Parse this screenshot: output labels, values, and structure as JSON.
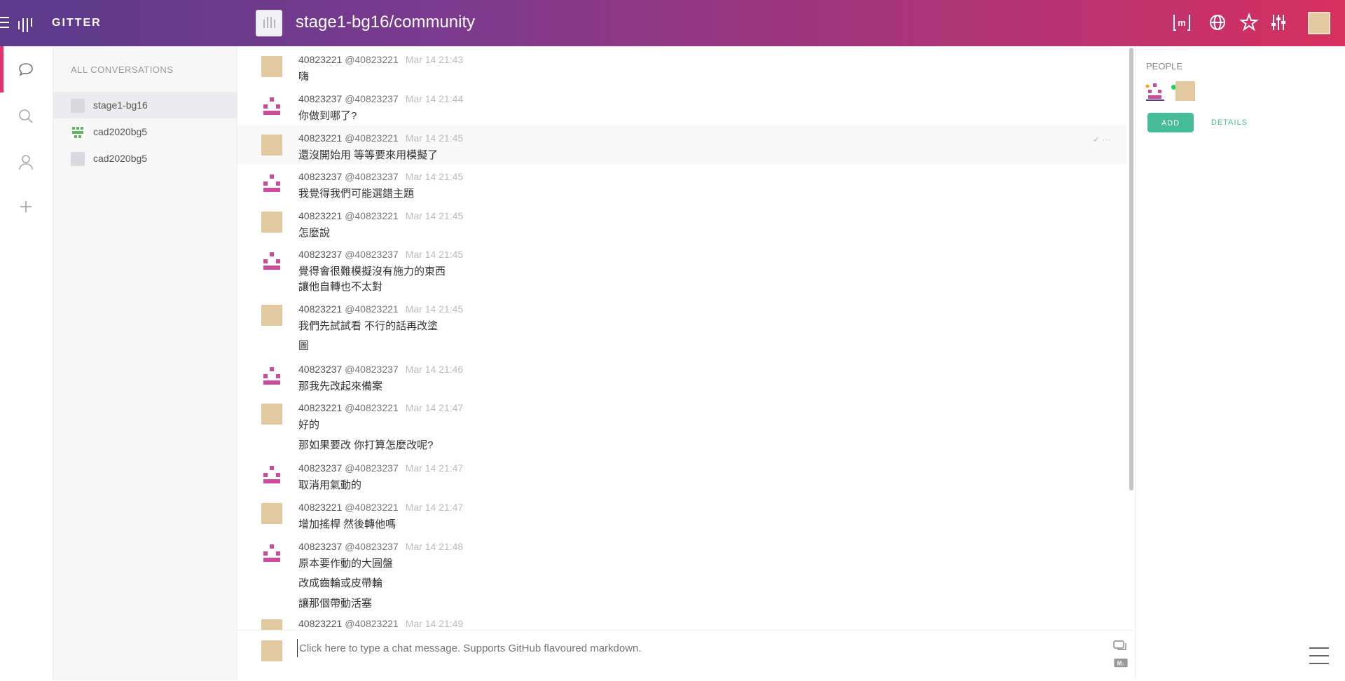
{
  "header": {
    "logo_text": "GITTER",
    "room_title": "stage1-bg16/community",
    "icons": [
      "matrix-icon",
      "globe-icon",
      "star-icon",
      "settings-sliders-icon"
    ],
    "matrix_label": "[m]",
    "accent": "#e8326b"
  },
  "left_nav": {
    "icons": [
      "chat-icon",
      "search-icon",
      "person-icon",
      "plus-icon"
    ]
  },
  "conversations": {
    "heading": "ALL CONVERSATIONS",
    "items": [
      {
        "label": "stage1-bg16",
        "active": true
      },
      {
        "label": "cad2020bg5",
        "active": false
      },
      {
        "label": "cad2020bg5",
        "active": false
      }
    ]
  },
  "messages": [
    {
      "name": "40823221",
      "user": "@40823221",
      "time": "Mar 14 21:43",
      "lines": [
        "嗨"
      ],
      "avatar": "b"
    },
    {
      "name": "40823237",
      "user": "@40823237",
      "time": "Mar 14 21:44",
      "lines": [
        "你做到哪了?"
      ],
      "avatar": "p"
    },
    {
      "name": "40823221",
      "user": "@40823221",
      "time": "Mar 14 21:45",
      "lines": [
        "還沒開始用 等等要來用模擬了"
      ],
      "avatar": "b"
    },
    {
      "name": "40823237",
      "user": "@40823237",
      "time": "Mar 14 21:45",
      "lines": [
        "我覺得我們可能選錯主題"
      ],
      "avatar": "p"
    },
    {
      "name": "40823221",
      "user": "@40823221",
      "time": "Mar 14 21:45",
      "lines": [
        "怎麼說"
      ],
      "avatar": "b"
    },
    {
      "name": "40823237",
      "user": "@40823237",
      "time": "Mar 14 21:45",
      "lines": [
        "覺得會很難模擬沒有施力的東西",
        "讓他自轉也不太對"
      ],
      "avatar": "p"
    },
    {
      "name": "40823221",
      "user": "@40823221",
      "time": "Mar 14 21:45",
      "lines": [
        "我們先試試看 不行的話再改塗",
        "圖"
      ],
      "avatar": "b"
    },
    {
      "name": "40823237",
      "user": "@40823237",
      "time": "Mar 14 21:46",
      "lines": [
        "那我先改起來備案"
      ],
      "avatar": "p"
    },
    {
      "name": "40823221",
      "user": "@40823221",
      "time": "Mar 14 21:47",
      "lines": [
        "好的",
        "那如果要改 你打算怎麼改呢?"
      ],
      "avatar": "b"
    },
    {
      "name": "40823237",
      "user": "@40823237",
      "time": "Mar 14 21:47",
      "lines": [
        "取消用氣動的"
      ],
      "avatar": "p"
    },
    {
      "name": "40823221",
      "user": "@40823221",
      "time": "Mar 14 21:47",
      "lines": [
        "增加搖桿 然後轉他嗎"
      ],
      "avatar": "b"
    },
    {
      "name": "40823237",
      "user": "@40823237",
      "time": "Mar 14 21:48",
      "lines": [
        "原本要作動的大圓盤",
        "改成齒輪或皮帶輪",
        "讓那個帶動活塞"
      ],
      "avatar": "p"
    },
    {
      "name": "40823221",
      "user": "@40823221",
      "time": "Mar 14 21:49",
      "lines": [],
      "avatar": "b"
    }
  ],
  "composer": {
    "placeholder": "Click here to type a chat message. Supports GitHub flavoured markdown."
  },
  "people": {
    "heading": "PEOPLE",
    "add_label": "ADD",
    "details_label": "DETAILS"
  }
}
